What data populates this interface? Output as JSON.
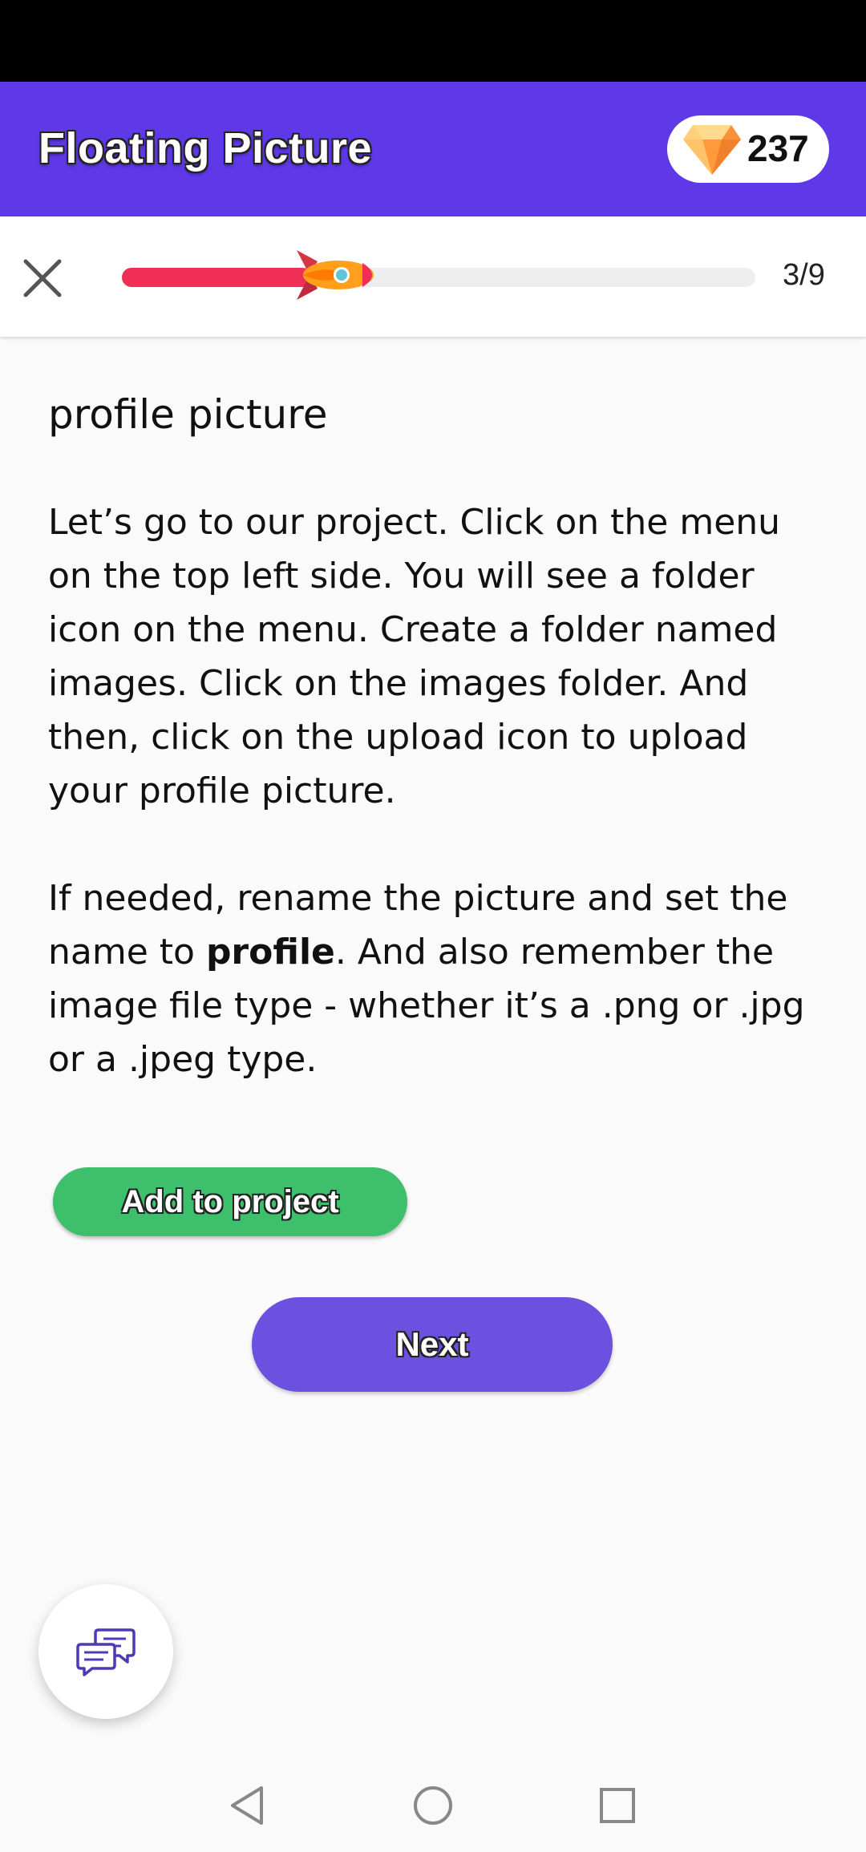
{
  "app_bar": {
    "title": "Floating Picture",
    "gem_count": "237",
    "gem_icon": "diamond-icon",
    "background_color": "#5f38e8"
  },
  "progress": {
    "close_icon": "close-icon",
    "counter": "3/9",
    "current_step": 3,
    "total_steps": 9,
    "fill_fraction": 0.3,
    "fill_color": "#ef2f55",
    "marker_icon": "rocket-icon"
  },
  "lesson": {
    "title": "profile picture",
    "paragraph_1": "Let’s go to our project. Click on the menu on the top left side. You will see a folder icon on the menu. Create a folder named images. Click on the images folder. And then, click on the upload icon to upload your profile picture.",
    "paragraph_2_before": "If needed, rename the picture and set the name to ",
    "paragraph_2_bold": "profile",
    "paragraph_2_after": ". And also remember the image file type - whether it’s a .png or .jpg or a .jpeg type."
  },
  "actions": {
    "add_label": "Add to project",
    "add_color": "#3ebf6b",
    "next_label": "Next",
    "next_color": "#6c50e0"
  },
  "chat_fab": {
    "icon": "chat-bubbles-icon"
  },
  "nav_bar": {
    "back_icon": "back-triangle-icon",
    "home_icon": "home-circle-icon",
    "recents_icon": "recents-square-icon"
  }
}
